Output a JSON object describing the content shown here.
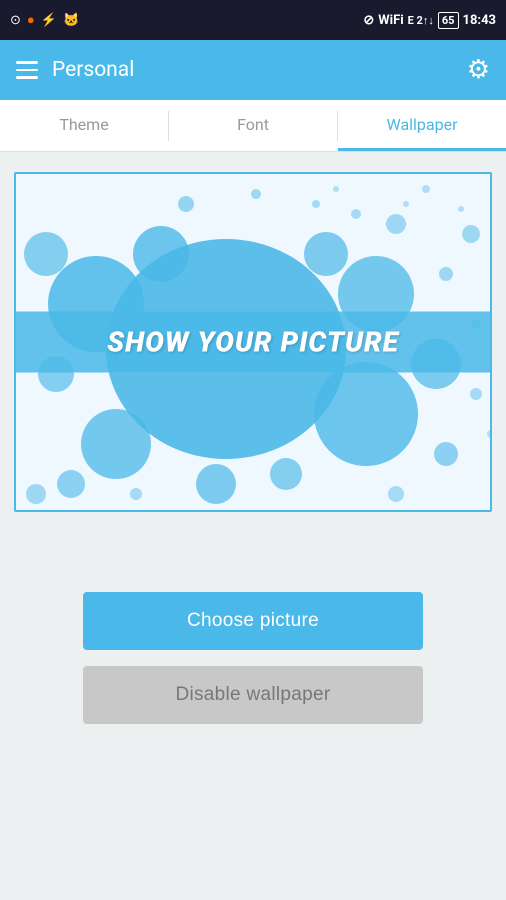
{
  "statusBar": {
    "time": "18:43",
    "batteryPercent": "65",
    "icons": [
      "app1",
      "app2",
      "usb",
      "android"
    ]
  },
  "header": {
    "title": "Personal",
    "settingsLabel": "settings"
  },
  "tabs": [
    {
      "id": "theme",
      "label": "Theme",
      "active": false
    },
    {
      "id": "font",
      "label": "Font",
      "active": false
    },
    {
      "id": "wallpaper",
      "label": "Wallpaper",
      "active": true
    }
  ],
  "wallpaperPreview": {
    "altText": "Wallpaper preview with splash circles",
    "bannerText": "SHOW YOUR PICTURE"
  },
  "buttons": {
    "choosePicture": "Choose picture",
    "disableWallpaper": "Disable wallpaper"
  }
}
